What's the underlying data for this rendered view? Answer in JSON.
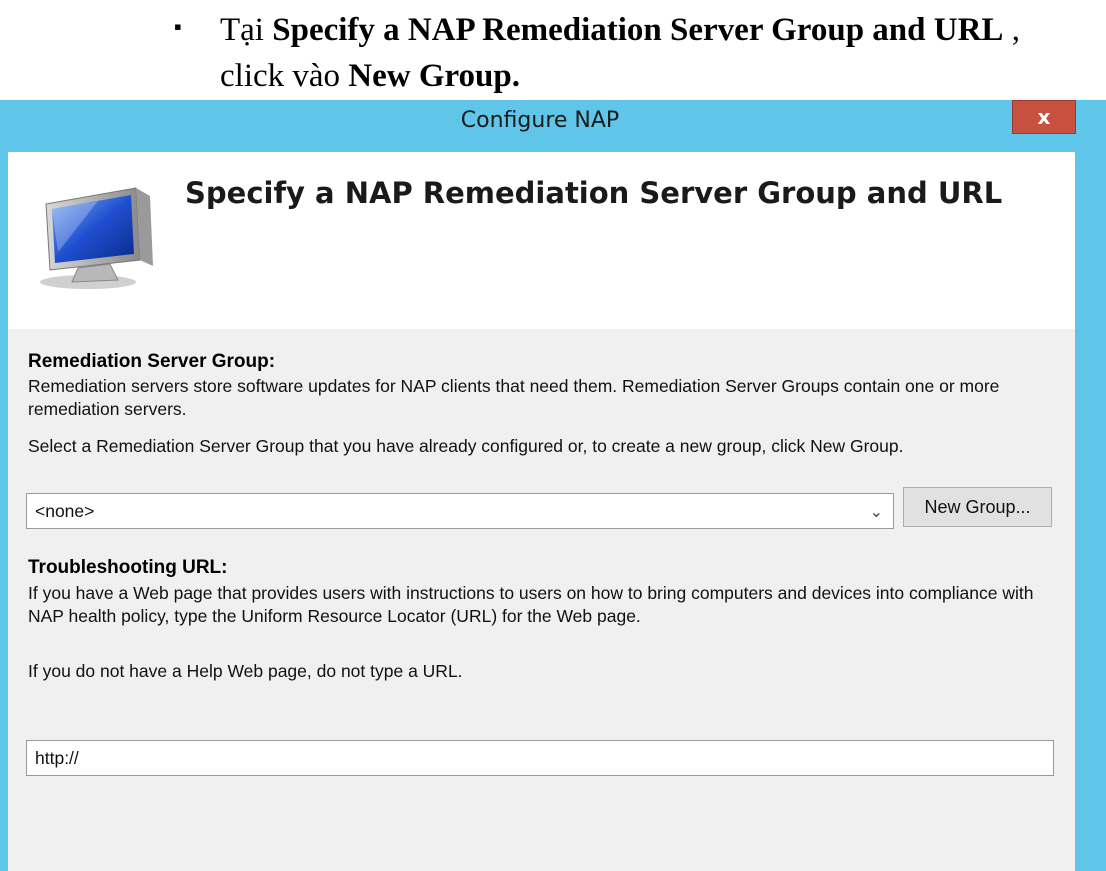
{
  "instruction": {
    "bullet": "▪",
    "line1_prefix": "Tại ",
    "line1_bold": "Specify a NAP Remediation Server Group and URL",
    "line1_suffix": " ,",
    "line2_prefix": "click vào ",
    "line2_bold": "New Group."
  },
  "window": {
    "title": "Configure NAP",
    "close_label": "x",
    "header_title": "Specify a NAP Remediation Server Group and URL",
    "icon": "computer-monitor-icon"
  },
  "remediation": {
    "heading": "Remediation Server Group:",
    "description": "Remediation servers store software updates for NAP clients that need them. Remediation Server Groups contain one or more remediation servers.",
    "instruction": "Select a Remediation Server Group that you have already configured or, to create a new group, click New Group.",
    "selected_group": "<none>",
    "new_group_label": "New Group..."
  },
  "troubleshooting": {
    "heading": "Troubleshooting URL:",
    "description": "If you have a Web page that provides users with instructions to users on how to bring computers and devices into compliance with NAP health policy, type the Uniform Resource Locator (URL) for the Web page.",
    "note": "If you do not have a Help Web page, do not type a URL.",
    "url_value": "http://"
  },
  "colors": {
    "titlebar": "#5fc6ea",
    "close_button": "#c7503f",
    "client_bg": "#f0f0f0"
  }
}
